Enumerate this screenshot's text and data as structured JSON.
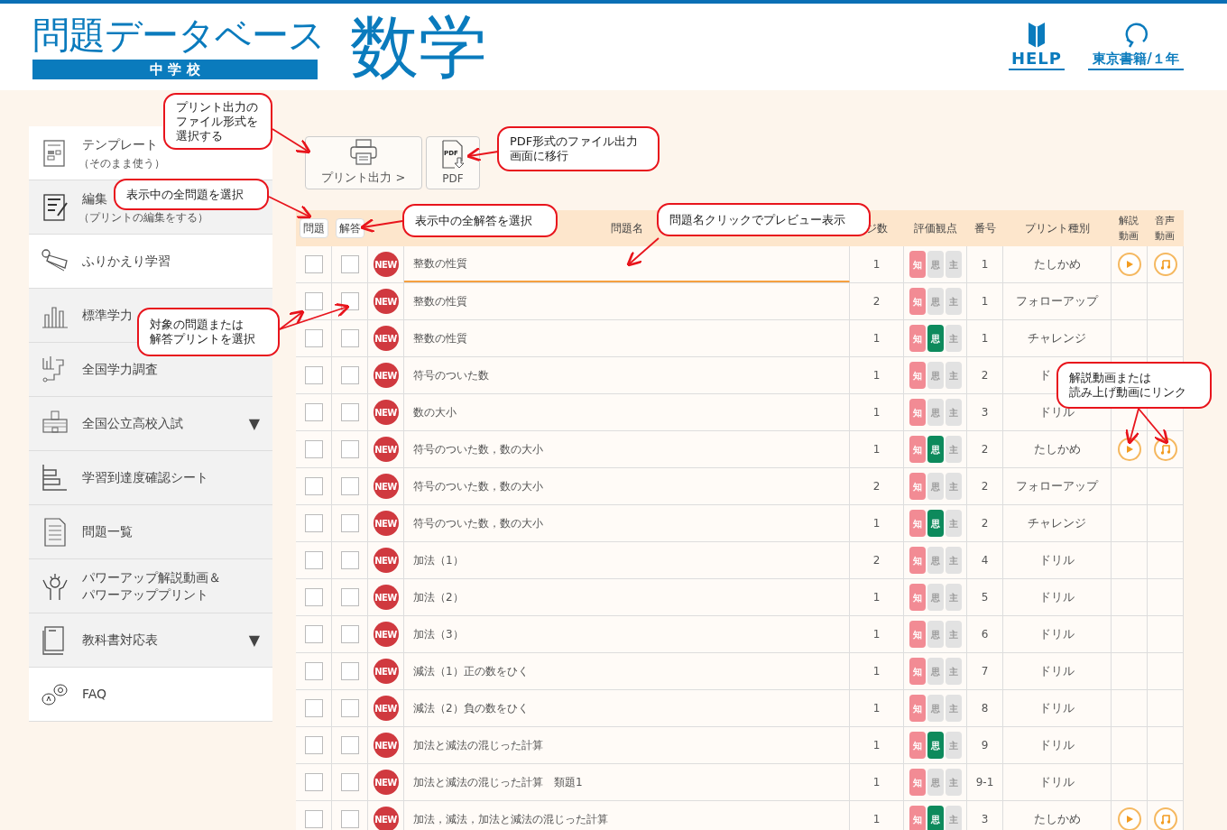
{
  "header": {
    "logo_title": "問題データベース",
    "logo_level": "中 学 校",
    "subject": "数学",
    "links": [
      {
        "label": "HELP"
      },
      {
        "label": "東京書籍/１年"
      }
    ]
  },
  "sidebar": {
    "items": [
      {
        "label": "テンプレート",
        "sub": "（そのまま使う）",
        "highlighted": true
      },
      {
        "label": "編集",
        "sub": "（プリントの編集をする）",
        "highlighted": false
      },
      {
        "label": "ふりかえり学習",
        "highlighted": true
      },
      {
        "label": "標準学力",
        "highlighted": false
      },
      {
        "label": "全国学力調査",
        "highlighted": false
      },
      {
        "label": "全国公立高校入試",
        "highlighted": false,
        "caret": "▼"
      },
      {
        "label": "学習到達度確認シート",
        "highlighted": false
      },
      {
        "label": "問題一覧",
        "highlighted": false
      },
      {
        "label": "パワーアップ解説動画＆パワーアッププリント",
        "highlighted": false
      },
      {
        "label": "教科書対応表",
        "highlighted": false,
        "caret": "▼"
      },
      {
        "label": "FAQ",
        "highlighted": true
      }
    ]
  },
  "toolbar": {
    "print_button": "プリント出力 >",
    "pdf_button": "PDF",
    "pdf_icon_text": "PDF"
  },
  "table": {
    "select_buttons": [
      "問題",
      "解答"
    ],
    "columns": [
      "問題名",
      "ジ数",
      "評価観点",
      "番号",
      "プリント種別",
      "解説動画",
      "音声動画"
    ],
    "rows": [
      {
        "q_checked": false,
        "a_checked": false,
        "badge": "NEW",
        "name": "整数の性質",
        "pages": "1",
        "eval": [
          {
            "label": "知",
            "on": true
          },
          {
            "label": "思",
            "on": false
          },
          {
            "label": "主",
            "on": false
          }
        ],
        "number": "1",
        "type": "たしかめ",
        "video": true,
        "audio": true,
        "highlighted": true
      },
      {
        "q_checked": false,
        "a_checked": false,
        "badge": "NEW",
        "name": "整数の性質",
        "pages": "2",
        "eval": [
          {
            "label": "知",
            "on": true
          },
          {
            "label": "思",
            "on": false
          },
          {
            "label": "主",
            "on": false
          }
        ],
        "number": "1",
        "type": "フォローアップ",
        "video": false,
        "audio": false,
        "highlighted": false
      },
      {
        "q_checked": false,
        "a_checked": false,
        "badge": "NEW",
        "name": "整数の性質",
        "pages": "1",
        "eval": [
          {
            "label": "知",
            "on": true
          },
          {
            "label": "思",
            "on": true
          },
          {
            "label": "主",
            "on": false
          }
        ],
        "number": "1",
        "type": "チャレンジ",
        "video": false,
        "audio": false,
        "highlighted": false
      },
      {
        "q_checked": false,
        "a_checked": false,
        "badge": "NEW",
        "name": "符号のついた数",
        "pages": "1",
        "eval": [
          {
            "label": "知",
            "on": true
          },
          {
            "label": "思",
            "on": false
          },
          {
            "label": "主",
            "on": false
          }
        ],
        "number": "2",
        "type": "ド",
        "video": false,
        "audio": false,
        "highlighted": false
      },
      {
        "q_checked": false,
        "a_checked": false,
        "badge": "NEW",
        "name": "数の大小",
        "pages": "1",
        "eval": [
          {
            "label": "知",
            "on": true
          },
          {
            "label": "思",
            "on": false
          },
          {
            "label": "主",
            "on": false
          }
        ],
        "number": "3",
        "type": "ドリル",
        "video": false,
        "audio": false,
        "highlighted": false
      },
      {
        "q_checked": false,
        "a_checked": false,
        "badge": "NEW",
        "name": "符号のついた数，数の大小",
        "pages": "1",
        "eval": [
          {
            "label": "知",
            "on": true
          },
          {
            "label": "思",
            "on": true
          },
          {
            "label": "主",
            "on": false
          }
        ],
        "number": "2",
        "type": "たしかめ",
        "video": true,
        "audio": true,
        "highlighted": false
      },
      {
        "q_checked": false,
        "a_checked": false,
        "badge": "NEW",
        "name": "符号のついた数，数の大小",
        "pages": "2",
        "eval": [
          {
            "label": "知",
            "on": true
          },
          {
            "label": "思",
            "on": false
          },
          {
            "label": "主",
            "on": false
          }
        ],
        "number": "2",
        "type": "フォローアップ",
        "video": false,
        "audio": false,
        "highlighted": false
      },
      {
        "q_checked": false,
        "a_checked": false,
        "badge": "NEW",
        "name": "符号のついた数，数の大小",
        "pages": "1",
        "eval": [
          {
            "label": "知",
            "on": true
          },
          {
            "label": "思",
            "on": true
          },
          {
            "label": "主",
            "on": false
          }
        ],
        "number": "2",
        "type": "チャレンジ",
        "video": false,
        "audio": false,
        "highlighted": false
      },
      {
        "q_checked": false,
        "a_checked": false,
        "badge": "NEW",
        "name": "加法（1）",
        "pages": "2",
        "eval": [
          {
            "label": "知",
            "on": true
          },
          {
            "label": "思",
            "on": false
          },
          {
            "label": "主",
            "on": false
          }
        ],
        "number": "4",
        "type": "ドリル",
        "video": false,
        "audio": false,
        "highlighted": false
      },
      {
        "q_checked": false,
        "a_checked": false,
        "badge": "NEW",
        "name": "加法（2）",
        "pages": "1",
        "eval": [
          {
            "label": "知",
            "on": true
          },
          {
            "label": "思",
            "on": false
          },
          {
            "label": "主",
            "on": false
          }
        ],
        "number": "5",
        "type": "ドリル",
        "video": false,
        "audio": false,
        "highlighted": false
      },
      {
        "q_checked": false,
        "a_checked": false,
        "badge": "NEW",
        "name": "加法（3）",
        "pages": "1",
        "eval": [
          {
            "label": "知",
            "on": true
          },
          {
            "label": "思",
            "on": false
          },
          {
            "label": "主",
            "on": false
          }
        ],
        "number": "6",
        "type": "ドリル",
        "video": false,
        "audio": false,
        "highlighted": false
      },
      {
        "q_checked": false,
        "a_checked": false,
        "badge": "NEW",
        "name": "減法（1）正の数をひく",
        "pages": "1",
        "eval": [
          {
            "label": "知",
            "on": true
          },
          {
            "label": "思",
            "on": false
          },
          {
            "label": "主",
            "on": false
          }
        ],
        "number": "7",
        "type": "ドリル",
        "video": false,
        "audio": false,
        "highlighted": false
      },
      {
        "q_checked": false,
        "a_checked": false,
        "badge": "NEW",
        "name": "減法（2）負の数をひく",
        "pages": "1",
        "eval": [
          {
            "label": "知",
            "on": true
          },
          {
            "label": "思",
            "on": false
          },
          {
            "label": "主",
            "on": false
          }
        ],
        "number": "8",
        "type": "ドリル",
        "video": false,
        "audio": false,
        "highlighted": false
      },
      {
        "q_checked": false,
        "a_checked": false,
        "badge": "NEW",
        "name": "加法と減法の混じった計算",
        "pages": "1",
        "eval": [
          {
            "label": "知",
            "on": true
          },
          {
            "label": "思",
            "on": true
          },
          {
            "label": "主",
            "on": false
          }
        ],
        "number": "9",
        "type": "ドリル",
        "video": false,
        "audio": false,
        "highlighted": false
      },
      {
        "q_checked": false,
        "a_checked": false,
        "badge": "NEW",
        "name": "加法と減法の混じった計算　類題1",
        "pages": "1",
        "eval": [
          {
            "label": "知",
            "on": true
          },
          {
            "label": "思",
            "on": false
          },
          {
            "label": "主",
            "on": false
          }
        ],
        "number": "9-1",
        "type": "ドリル",
        "video": false,
        "audio": false,
        "highlighted": false
      },
      {
        "q_checked": false,
        "a_checked": false,
        "badge": "NEW",
        "name": "加法，減法，加法と減法の混じった計算",
        "pages": "1",
        "eval": [
          {
            "label": "知",
            "on": true
          },
          {
            "label": "思",
            "on": true
          },
          {
            "label": "主",
            "on": false
          }
        ],
        "number": "3",
        "type": "たしかめ",
        "video": true,
        "audio": true,
        "highlighted": false
      }
    ]
  },
  "callouts": [
    {
      "lines": [
        "プリント出力の",
        "ファイル形式を",
        "選択する"
      ]
    },
    {
      "lines": [
        "表示中の全問題を選択"
      ]
    },
    {
      "lines": [
        "表示中の全解答を選択"
      ]
    },
    {
      "lines": [
        "PDF形式のファイル出力",
        "画面に移行"
      ]
    },
    {
      "lines": [
        "問題名クリックでプレビュー表示"
      ]
    },
    {
      "lines": [
        "対象の問題または",
        "解答プリントを選択"
      ]
    },
    {
      "lines": [
        "解説動画または",
        "読み上げ動画にリンク"
      ]
    }
  ]
}
